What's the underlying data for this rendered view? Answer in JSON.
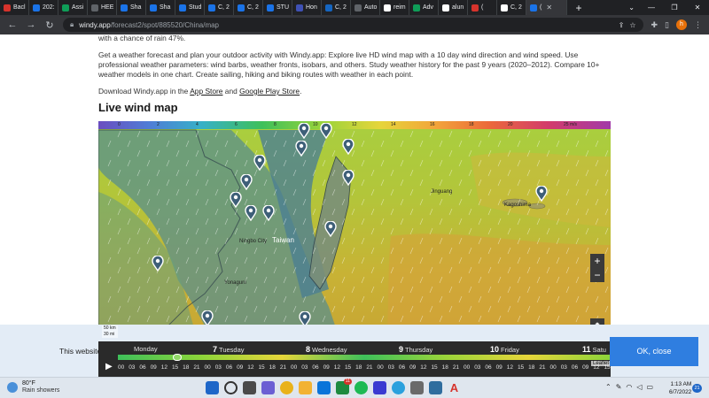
{
  "browser": {
    "tabs": [
      {
        "label": "Bacl",
        "color": "#d6332c"
      },
      {
        "label": "202:",
        "color": "#1a73e8"
      },
      {
        "label": "Assi",
        "color": "#0f9d58"
      },
      {
        "label": "HEE",
        "color": "#5f6368"
      },
      {
        "label": "Sha",
        "color": "#1a73e8"
      },
      {
        "label": "Sha",
        "color": "#1a73e8"
      },
      {
        "label": "Stud",
        "color": "#1a73e8"
      },
      {
        "label": "C, 2",
        "color": "#1a73e8"
      },
      {
        "label": "C, 2",
        "color": "#1a73e8"
      },
      {
        "label": "STU",
        "color": "#1a73e8"
      },
      {
        "label": "Hon",
        "color": "#3f51b5"
      },
      {
        "label": "C, 2",
        "color": "#1565c0"
      },
      {
        "label": "Auto",
        "color": "#5f6368"
      },
      {
        "label": "reim",
        "color": "#ffffff"
      },
      {
        "label": "Adv",
        "color": "#0f9d58"
      },
      {
        "label": "alun",
        "color": "#ffffff"
      },
      {
        "label": "(",
        "color": "#d6332c"
      },
      {
        "label": "C, 2",
        "color": "#ffffff"
      },
      {
        "label": "(",
        "color": "#1a73e8"
      }
    ],
    "url_host": "windy.app",
    "url_path": "/forecast2/spot/885520/China/map",
    "profile_initial": "h"
  },
  "page": {
    "p1": "with a chance of rain 47%.",
    "p2": "Get a weather forecast and plan your outdoor activity with Windy.app: Explore live HD wind map with a 10 day wind direction and wind speed. Use professional weather parameters: wind barbs, weather fronts, isobars, and others. Study weather history for the past 9 years (2020–2012). Compare 10+ weather models in one chart. Create sailing, hiking and biking routes with weather in each point.",
    "p3_prefix": "Download Windy.app in the",
    "p3_link1": "App Store",
    "p3_and": "and",
    "p3_link2": "Google Play Store",
    "p3_suffix": ".",
    "heading": "Live wind map"
  },
  "map": {
    "scale_labels": [
      "0",
      "2",
      "4",
      "6",
      "8",
      "10",
      "12",
      "14",
      "16",
      "18",
      "20",
      "25 m/s"
    ],
    "zoom_in": "+",
    "zoom_out": "−",
    "hd_label": "HD",
    "cities": [
      "Ningbo City",
      "Taiwan",
      "Yonaguni",
      "Jinguang",
      "Kagoshima"
    ],
    "scale_km": "50 km",
    "scale_mi": "30 mi",
    "leaflet": "Leaflet"
  },
  "timeline": {
    "days": [
      {
        "num": "",
        "name": "Monday"
      },
      {
        "num": "7",
        "name": "Tuesday"
      },
      {
        "num": "8",
        "name": "Wednesday"
      },
      {
        "num": "9",
        "name": "Thursday"
      },
      {
        "num": "10",
        "name": "Friday"
      },
      {
        "num": "11",
        "name": "Satu"
      }
    ],
    "hours": [
      "00",
      "03",
      "06",
      "09",
      "12",
      "15",
      "18",
      "21",
      "00",
      "03",
      "06",
      "09",
      "12",
      "15",
      "18",
      "21",
      "00",
      "03",
      "06",
      "09",
      "12",
      "15",
      "18",
      "21",
      "00",
      "03",
      "06",
      "09",
      "12",
      "15",
      "18",
      "21",
      "00",
      "03",
      "06",
      "09",
      "12",
      "15",
      "18",
      "21",
      "00",
      "03",
      "06",
      "09",
      "12",
      "15"
    ],
    "play": "▶"
  },
  "cookie": {
    "text": "This website",
    "button": "OK, close"
  },
  "taskbar": {
    "temp": "80°F",
    "condition": "Rain showers",
    "badge": "11",
    "time": "1:13 AM",
    "date": "6/7/2022",
    "notifications": "21"
  }
}
